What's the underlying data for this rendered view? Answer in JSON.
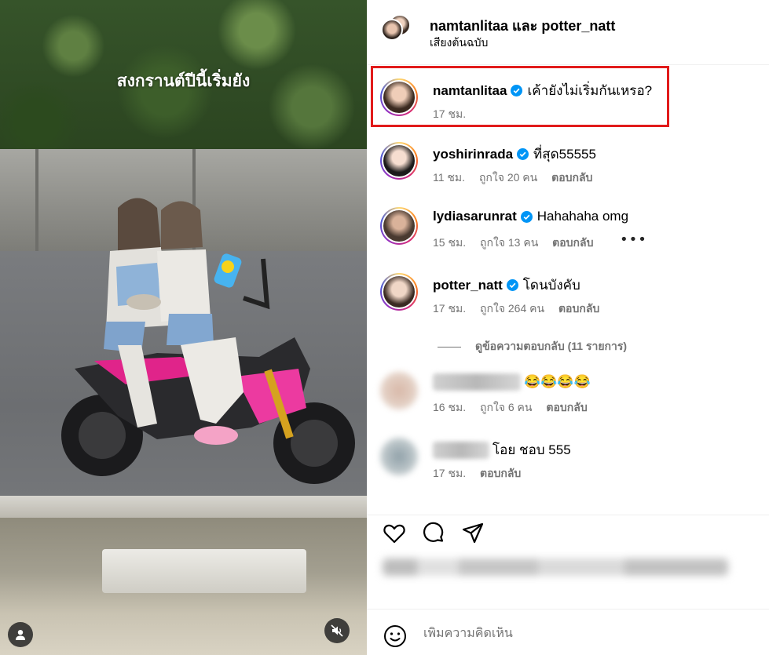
{
  "media": {
    "caption": "สงกรานต์ปีนี้เริ่มยัง"
  },
  "header": {
    "user1": "namtanlitaa",
    "and": "และ",
    "user2": "potter_natt",
    "audio": "เสียงต้นฉบับ"
  },
  "comments": [
    {
      "user": "namtanlitaa",
      "text": "เค้ายังไม่เริ่มกันเหรอ?",
      "time": "17 ชม.",
      "likes": "",
      "reply": "",
      "verified": true,
      "highlighted": true
    },
    {
      "user": "yoshirinrada",
      "text": "ที่สุด55555",
      "time": "11 ชม.",
      "likes": "ถูกใจ 20 คน",
      "reply": "ตอบกลับ",
      "verified": true
    },
    {
      "user": "lydiasarunrat",
      "text": "Hahahaha omg",
      "time": "15 ชม.",
      "likes": "ถูกใจ 13 คน",
      "reply": "ตอบกลับ",
      "verified": true,
      "more": "•••"
    },
    {
      "user": "potter_natt",
      "text": "โดนบังคับ",
      "time": "17 ชม.",
      "likes": "ถูกใจ 264 คน",
      "reply": "ตอบกลับ",
      "verified": true
    },
    {
      "user": "",
      "text": "😂😂😂😂",
      "time": "16 ชม.",
      "likes": "ถูกใจ 6 คน",
      "reply": "ตอบกลับ",
      "verified": false,
      "blurred": true
    },
    {
      "user": "",
      "text": "โอย ชอบ 555",
      "time": "17 ชม.",
      "likes": "",
      "reply": "ตอบกลับ",
      "verified": false,
      "blurred": true
    }
  ],
  "view_replies": "ดูข้อความตอบกลับ (11 รายการ)",
  "comment_box": {
    "placeholder": "เพิ่มความคิดเห็น"
  },
  "colors": {
    "verified": "#0095f6",
    "highlight": "#e11b1b",
    "meta": "#737373"
  },
  "icons": {
    "like": "heart-icon",
    "comment": "comment-icon",
    "share": "share-icon",
    "emoji": "emoji-icon",
    "user_tag": "user-icon",
    "mute": "muted-speaker-icon"
  }
}
